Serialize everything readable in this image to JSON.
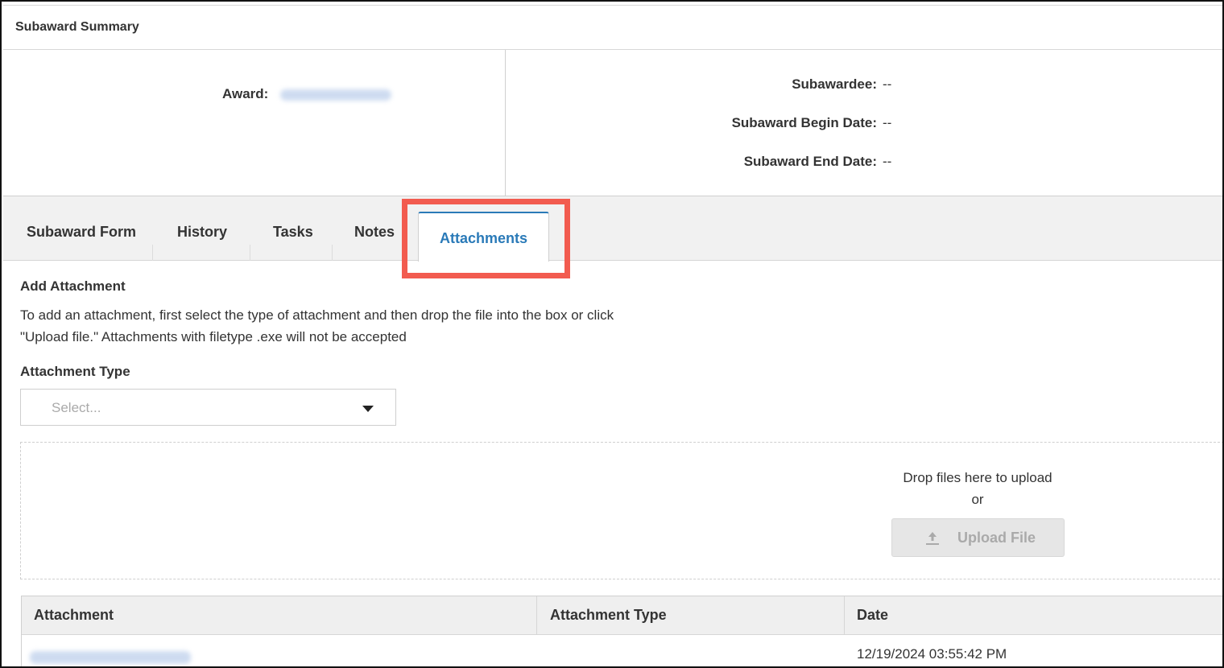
{
  "summary": {
    "title": "Subaward Summary",
    "award_label": "Award:",
    "award_value": "",
    "subawardee_label": "Subawardee:",
    "subawardee_value": "--",
    "begin_label": "Subaward Begin Date:",
    "begin_value": "--",
    "end_label": "Subaward End Date:",
    "end_value": "--"
  },
  "tabs": [
    {
      "label": "Subaward Form",
      "active": false
    },
    {
      "label": "History",
      "active": false
    },
    {
      "label": "Tasks",
      "active": false
    },
    {
      "label": "Notes",
      "active": false
    },
    {
      "label": "Attachments",
      "active": true
    }
  ],
  "attachment_section": {
    "title": "Add Attachment",
    "help_line1": "To add an attachment, first select the type of attachment and then drop the file into the box or click",
    "help_line2": "\"Upload file.\" Attachments with filetype .exe will not be accepted",
    "type_label": "Attachment Type",
    "type_placeholder": "Select...",
    "drop_text": "Drop files here to upload",
    "drop_or": "or",
    "upload_label": "Upload File"
  },
  "table": {
    "columns": [
      "Attachment",
      "Attachment Type",
      "Date"
    ],
    "rows": [
      {
        "attachment": "",
        "type": "",
        "date": "12/19/2024 03:55:42 PM"
      }
    ]
  },
  "colors": {
    "accent": "#2a7ab8",
    "highlight": "#f25b4f"
  },
  "icons": {
    "dropdown": "caret-down-icon",
    "upload": "upload-icon"
  }
}
